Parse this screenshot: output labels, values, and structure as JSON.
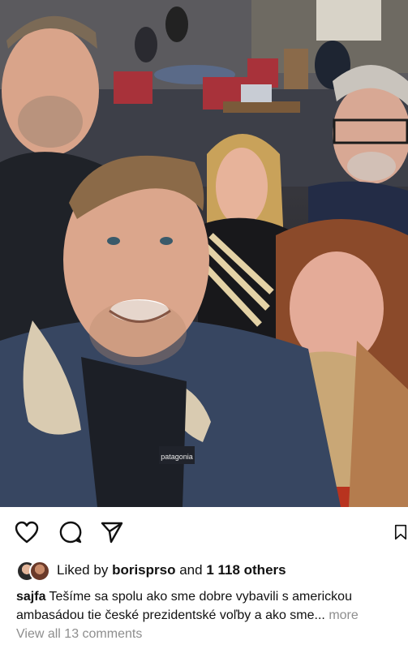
{
  "post": {
    "liked_prefix": "Liked by",
    "liked_user": "borisprso",
    "liked_and": "and",
    "liked_count": "1 118 others",
    "caption_user": "sajfa",
    "caption_line1": "Tešíme sa spolu ako sme dobre vybavili s americkou",
    "caption_line2": "ambasádou tie české prezidentské voľby a ako sme...",
    "more_label": "more",
    "view_comments": "View all 13 comments"
  },
  "photo": {
    "jacket_brand": "patagonia"
  },
  "icons": [
    "heart-icon",
    "comment-icon",
    "share-icon",
    "bookmark-icon"
  ],
  "colors": {
    "text": "#111111",
    "muted": "#8e8e8e",
    "background": "#ffffff"
  }
}
